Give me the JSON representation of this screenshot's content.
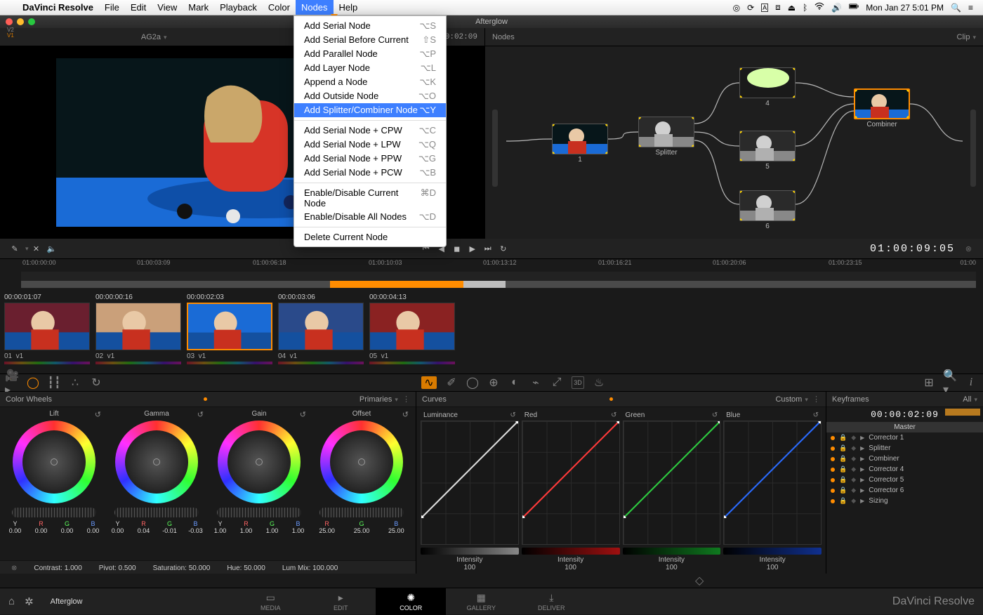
{
  "os": {
    "app": "DaVinci Resolve",
    "menus": [
      "File",
      "Edit",
      "View",
      "Mark",
      "Playback",
      "Color",
      "Nodes",
      "Help"
    ],
    "active_menu": "Nodes",
    "clock": "Mon Jan 27  5:01 PM"
  },
  "nodes_menu": [
    {
      "label": "Add Serial Node",
      "key": "⌥S"
    },
    {
      "label": "Add Serial Before Current",
      "key": "⇧S"
    },
    {
      "label": "Add Parallel Node",
      "key": "⌥P"
    },
    {
      "label": "Add Layer Node",
      "key": "⌥L"
    },
    {
      "label": "Append a Node",
      "key": "⌥K"
    },
    {
      "label": "Add Outside Node",
      "key": "⌥O"
    },
    {
      "label": "Add Splitter/Combiner Node",
      "key": "⌥Y",
      "sel": true
    },
    {
      "sep": true
    },
    {
      "label": "Add Serial Node + CPW",
      "key": "⌥C"
    },
    {
      "label": "Add Serial Node + LPW",
      "key": "⌥Q"
    },
    {
      "label": "Add Serial Node + PPW",
      "key": "⌥G"
    },
    {
      "label": "Add Serial Node + PCW",
      "key": "⌥B"
    },
    {
      "sep": true
    },
    {
      "label": "Enable/Disable Current Node",
      "key": "⌘D"
    },
    {
      "label": "Enable/Disable All Nodes",
      "key": "⌥D"
    },
    {
      "sep": true
    },
    {
      "label": "Delete Current Node",
      "key": ""
    }
  ],
  "window_title": "Afterglow",
  "viewer": {
    "clip": "AG2a",
    "tc_head": "01:00:02:09",
    "tc_current": "01:00:09:05"
  },
  "nodes_head": {
    "left": "Nodes",
    "right": "Clip"
  },
  "nodes": {
    "n1": "1",
    "splitter": "Splitter",
    "n4": "4",
    "n5": "5",
    "n6": "6",
    "combiner": "Combiner"
  },
  "ruler": [
    "01:00:00:00",
    "01:00:03:09",
    "01:00:06:18",
    "01:00:10:03",
    "01:00:13:12",
    "01:00:16:21",
    "01:00:20:06",
    "01:00:23:15"
  ],
  "ruler_right": "01:00",
  "tracks": {
    "v1": "V1",
    "v2": "V2"
  },
  "thumbs": [
    {
      "tc": "00:00:01:07",
      "id": "01",
      "track": "v1"
    },
    {
      "tc": "00:00:00:16",
      "id": "02",
      "track": "v1"
    },
    {
      "tc": "00:00:02:03",
      "id": "03",
      "track": "v1",
      "sel": true
    },
    {
      "tc": "00:00:03:06",
      "id": "04",
      "track": "v1"
    },
    {
      "tc": "00:00:04:13",
      "id": "05",
      "track": "v1"
    }
  ],
  "cw": {
    "title": "Color Wheels",
    "mode": "Primaries",
    "wheels": [
      {
        "name": "Lift",
        "vals": {
          "Y": "0.00",
          "R": "0.00",
          "G": "0.00",
          "B": "0.00"
        }
      },
      {
        "name": "Gamma",
        "vals": {
          "Y": "0.00",
          "R": "0.04",
          "G": "-0.01",
          "B": "-0.03"
        }
      },
      {
        "name": "Gain",
        "vals": {
          "Y": "1.00",
          "R": "1.00",
          "G": "1.00",
          "B": "1.00"
        }
      },
      {
        "name": "Offset",
        "vals": {
          "R": "25.00",
          "G": "25.00",
          "B": "25.00"
        }
      }
    ],
    "params": {
      "contrast": "Contrast:  1.000",
      "pivot": "Pivot:  0.500",
      "saturation": "Saturation:  50.000",
      "hue": "Hue:  50.000",
      "lummix": "Lum Mix:  100.000"
    }
  },
  "curves": {
    "title": "Curves",
    "mode": "Custom",
    "cols": [
      {
        "name": "Luminance",
        "intensity": "100",
        "color": "#dcdcdc",
        "slider": "#888"
      },
      {
        "name": "Red",
        "intensity": "100",
        "color": "#ff3a3a",
        "slider": "#a01010"
      },
      {
        "name": "Green",
        "intensity": "100",
        "color": "#2ecc40",
        "slider": "#0f7a1f"
      },
      {
        "name": "Blue",
        "intensity": "100",
        "color": "#2a6bff",
        "slider": "#10308f"
      }
    ],
    "intensity_label": "Intensity"
  },
  "keyframes": {
    "title": "Keyframes",
    "filter": "All",
    "tc": "00:00:02:09",
    "master": "Master",
    "rows": [
      "Corrector 1",
      "Splitter",
      "Combiner",
      "Corrector 4",
      "Corrector 5",
      "Corrector 6",
      "Sizing"
    ]
  },
  "pages": [
    "MEDIA",
    "EDIT",
    "COLOR",
    "GALLERY",
    "DELIVER"
  ],
  "project": "Afterglow",
  "brand": "DaVinci Resolve"
}
